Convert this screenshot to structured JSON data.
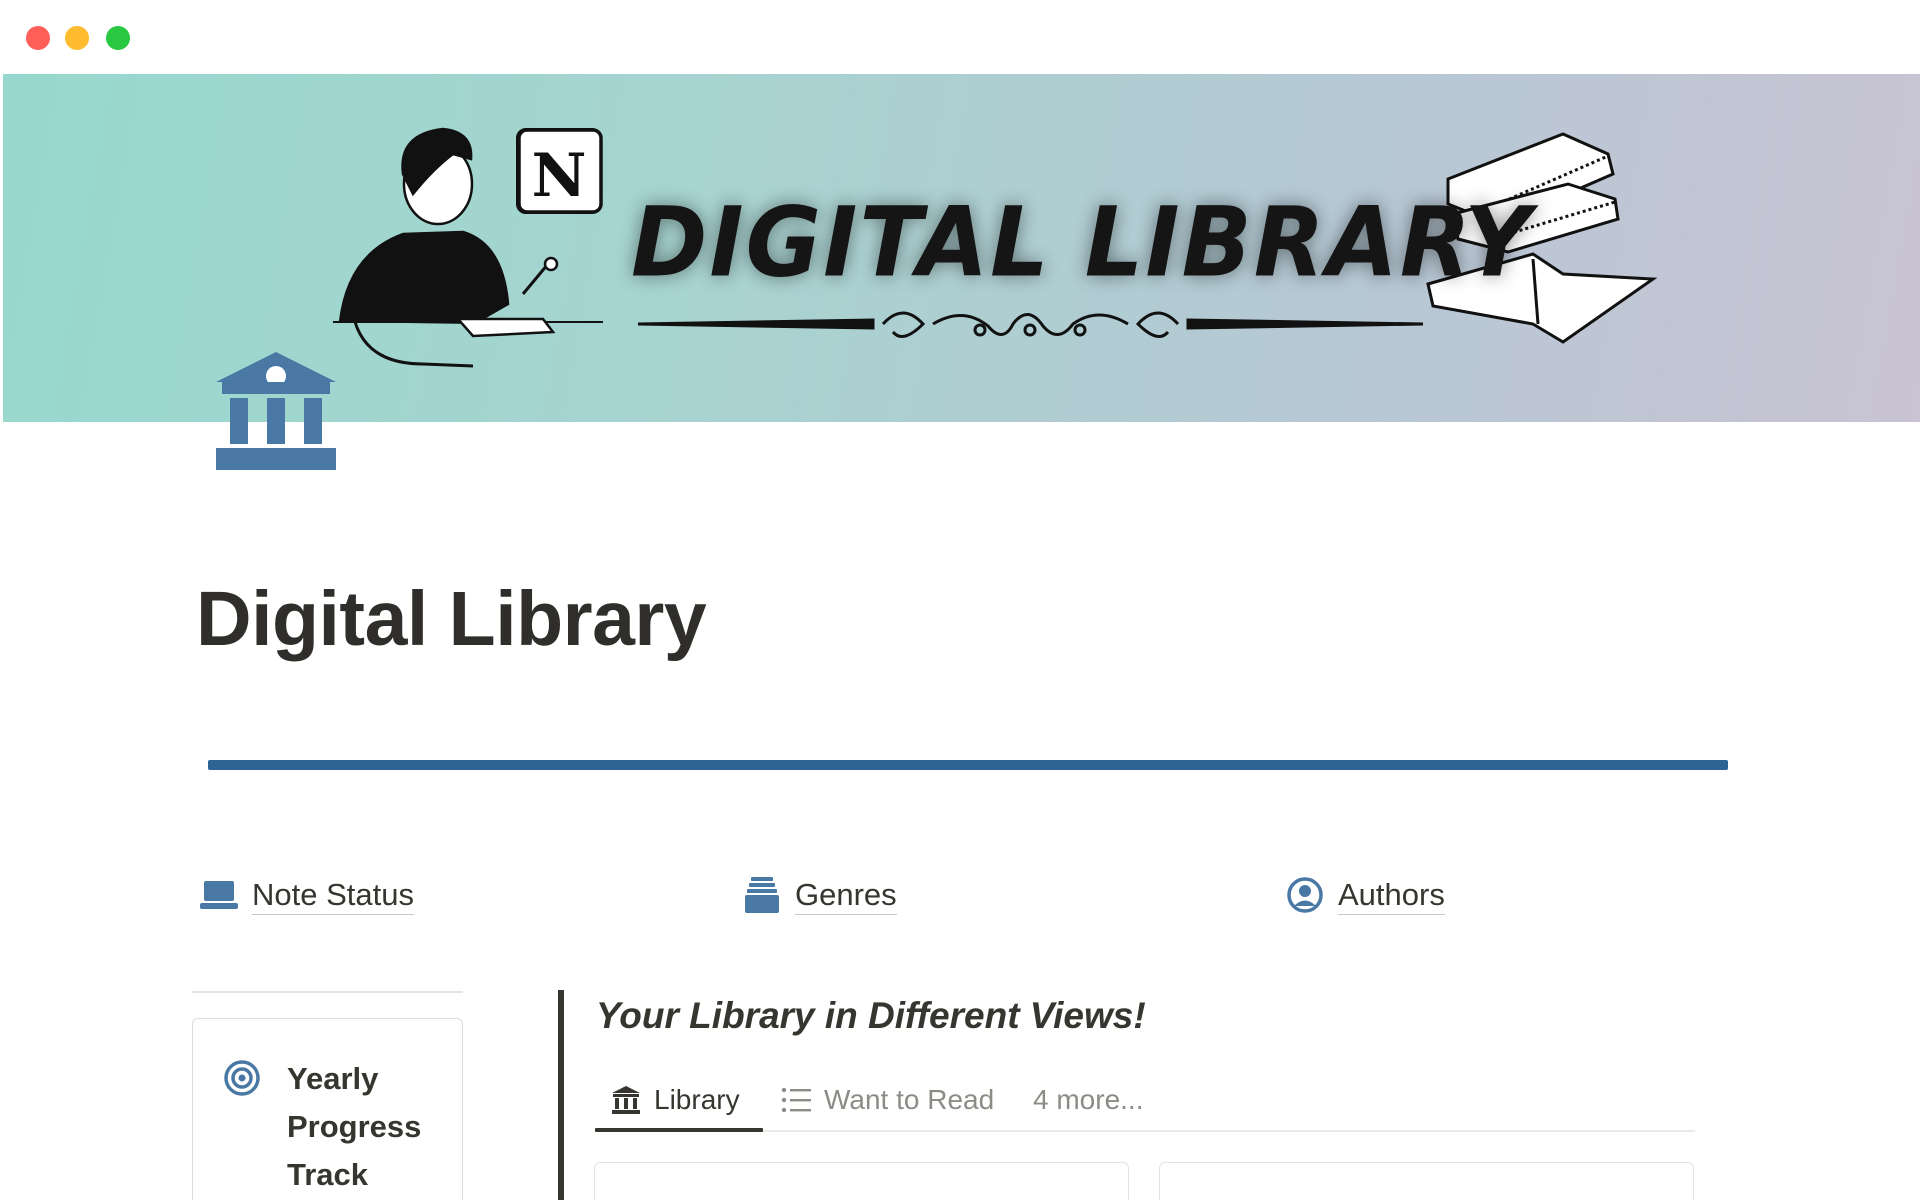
{
  "window": {
    "controls": [
      "close",
      "minimize",
      "zoom"
    ]
  },
  "cover": {
    "title_text": "DIGITAL LIBRARY",
    "notion_badge": "N",
    "colors": {
      "gradient_start": "#96d8cd",
      "gradient_end": "#c9c3d3"
    }
  },
  "page": {
    "icon": "bank-building-icon",
    "title": "Digital Library",
    "accent_color": "#2e6495"
  },
  "links": [
    {
      "label": "Note Status",
      "icon": "laptop-icon"
    },
    {
      "label": "Genres",
      "icon": "archive-drawer-icon"
    },
    {
      "label": "Authors",
      "icon": "user-circle-icon"
    }
  ],
  "sidebar_card": {
    "icon": "target-icon",
    "title": "Yearly Progress Track"
  },
  "callout": {
    "heading": "Your Library in Different Views!"
  },
  "tabs": [
    {
      "label": "Library",
      "icon": "bank-building-icon",
      "active": true
    },
    {
      "label": "Want to Read",
      "icon": "list-icon",
      "active": false
    },
    {
      "label": "4 more...",
      "icon": "",
      "active": false
    }
  ]
}
